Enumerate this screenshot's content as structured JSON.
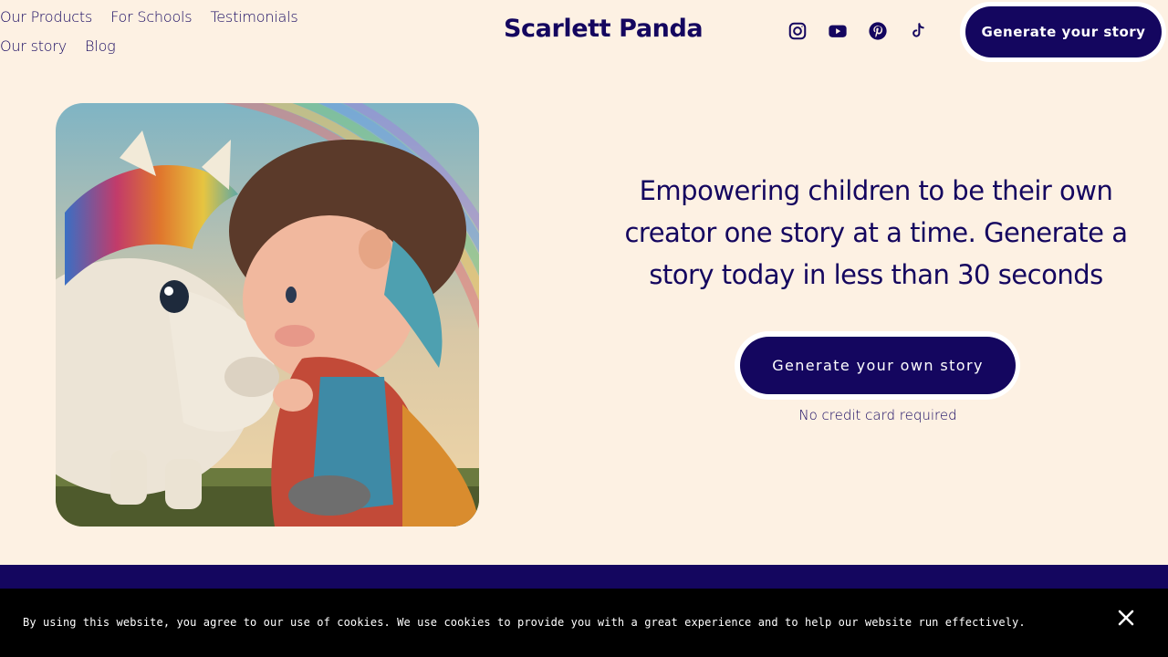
{
  "nav": {
    "links": [
      {
        "label": "Our Products"
      },
      {
        "label": "For Schools"
      },
      {
        "label": "Testimonials"
      },
      {
        "label": "Our story"
      },
      {
        "label": "Blog"
      }
    ]
  },
  "brand": {
    "name": "Scarlett Panda",
    "primary_color": "#14065f",
    "background_color": "#fdf1e3"
  },
  "socials": [
    {
      "icon": "instagram-icon"
    },
    {
      "icon": "youtube-icon"
    },
    {
      "icon": "pinterest-icon"
    },
    {
      "icon": "tiktok-icon"
    }
  ],
  "header": {
    "cta_label": "Generate your story"
  },
  "hero": {
    "image_icon": "unicorn-and-girl-illustration",
    "headline": "Empowering children to be their own creator one story at a time. Generate a story today in less than 30 seconds",
    "cta_label": "Generate your own story",
    "note": "No credit card required"
  },
  "cookie_banner": {
    "text": "By using this website, you agree to our use of cookies. We use cookies to provide you with a great experience and to help our website run effectively.",
    "close_icon": "close-icon"
  }
}
